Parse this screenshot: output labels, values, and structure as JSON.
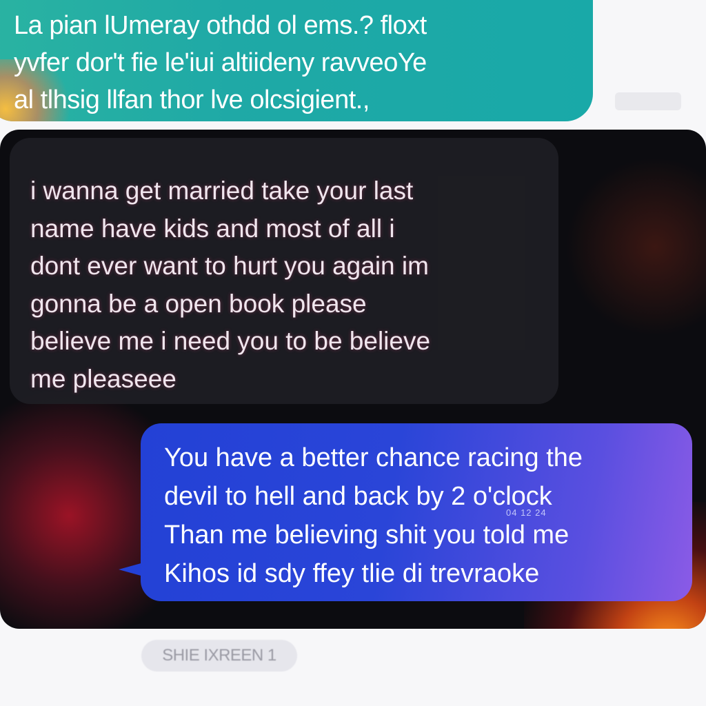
{
  "top_message": {
    "lines": [
      "La pian lUmeray othdd ol ems.? floxt",
      "yvfer dor't fie le'iui altiideny ravveoYe",
      "al tlhsig llfan thor lve olcsigient.,"
    ]
  },
  "received_message": {
    "text": "i wanna get married take your last\nname have kids and most of all i\ndont ever want to hurt you again im\ngonna be a open book please\nbelieve me i need you to be believe\nme pleaseee"
  },
  "sent_message": {
    "lines": [
      "You have a better chance racing the",
      "devil to hell and back by 2 o'clock",
      "Than me believing shit you told me",
      "Kihos id sdy ffey tlie di trevraoke"
    ],
    "timestamp_overlay": "04 12 24"
  },
  "status_pill": {
    "label": "SHIE IXREEN 1"
  },
  "colors": {
    "top_bubble": "#1fa9a6",
    "received_bubble": "#1e1e24",
    "sent_bubble_start": "#2341d6",
    "sent_bubble_end": "#8b5be6",
    "panel_background": "#0c0c10"
  }
}
